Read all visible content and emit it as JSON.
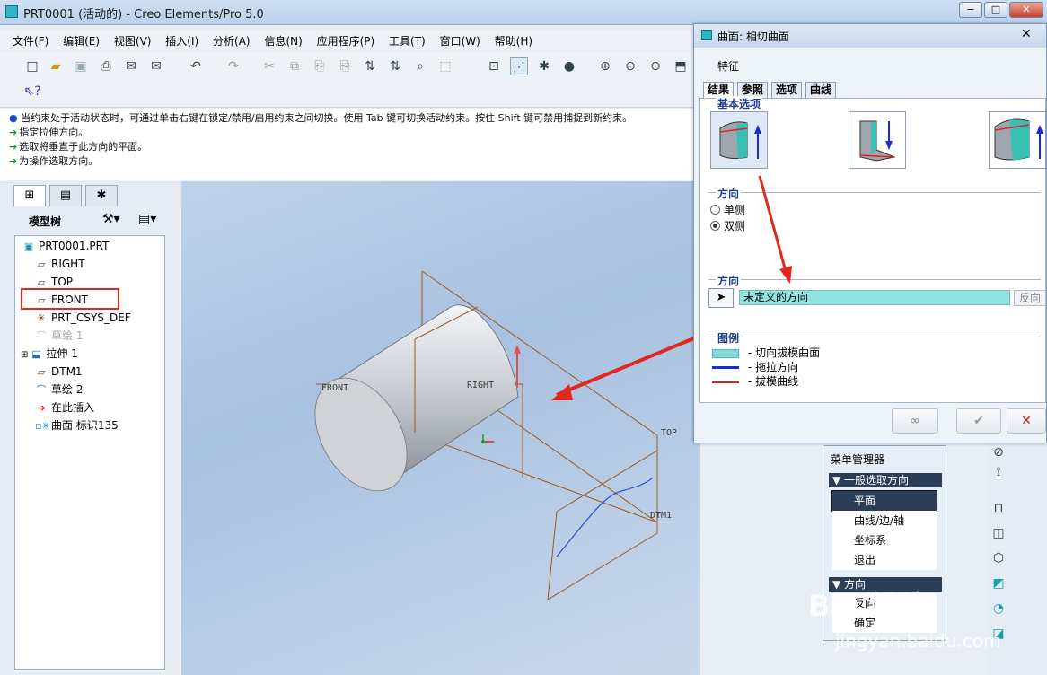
{
  "window": {
    "title": "PRT0001 (活动的) - Creo Elements/Pro 5.0",
    "controls": [
      "−",
      "□",
      "✕"
    ]
  },
  "menubar": [
    "文件(F)",
    "编辑(E)",
    "视图(V)",
    "插入(I)",
    "分析(A)",
    "信息(N)",
    "应用程序(P)",
    "工具(T)",
    "窗口(W)",
    "帮助(H)"
  ],
  "messages": [
    "当约束处于活动状态时，可通过单击右键在锁定/禁用/启用约束之间切换。使用 Tab 键可切换活动约束。按住 Shift 键可禁用捕捉到新约束。",
    "指定拉伸方向。",
    "选取将垂直于此方向的平面。",
    "为操作选取方向。"
  ],
  "model_tree": {
    "header": "模型树",
    "items": [
      {
        "label": "PRT0001.PRT",
        "icon": "part-icon"
      },
      {
        "label": "RIGHT",
        "icon": "datum-plane-icon"
      },
      {
        "label": "TOP",
        "icon": "datum-plane-icon"
      },
      {
        "label": "FRONT",
        "icon": "datum-plane-icon"
      },
      {
        "label": "PRT_CSYS_DEF",
        "icon": "csys-icon"
      },
      {
        "label": "草绘 1",
        "icon": "sketch-icon"
      },
      {
        "label": "拉伸 1",
        "icon": "extrude-icon"
      },
      {
        "label": "DTM1",
        "icon": "datum-plane-icon"
      },
      {
        "label": "草绘 2",
        "icon": "sketch-icon"
      },
      {
        "label": "在此插入",
        "icon": "insert-here-icon"
      },
      {
        "label": "曲面 标识135",
        "icon": "surface-icon"
      }
    ]
  },
  "viewport_labels": {
    "front": "FRONT",
    "right": "RIGHT",
    "top": "TOP",
    "dtm1": "DTM1"
  },
  "dialog": {
    "title": "曲面: 相切曲面",
    "feature_label": "特征",
    "tabs": [
      "结果",
      "参照",
      "选项",
      "曲线"
    ],
    "basic_options": "基本选项",
    "direction_group_1": "方向",
    "radio_single": "单侧",
    "radio_double": "双侧",
    "direction_group_2": "方向",
    "direction_value": "未定义的方向",
    "reverse": "反向",
    "legend_title": "图例",
    "legend": [
      {
        "label": "切向拔模曲面",
        "color": "#7fdcd6"
      },
      {
        "label": "拖拉方向",
        "color": "#1a2bd6"
      },
      {
        "label": "拔模曲线",
        "color": "#d42020"
      }
    ]
  },
  "menu_manager": {
    "title": "菜单管理器",
    "section1": "一般选取方向",
    "items": [
      "平面",
      "曲线/边/轴",
      "坐标系",
      "退出"
    ],
    "section2": "方向",
    "items2": [
      "反向",
      "确定"
    ]
  },
  "watermark": {
    "logo": "Bai 经验",
    "url": "jingyan.baidu.com"
  },
  "colors": {
    "highlight_box": "#e0281e",
    "annotation_arrow": "#e0281e",
    "datum_lines": "#9a5a22"
  }
}
